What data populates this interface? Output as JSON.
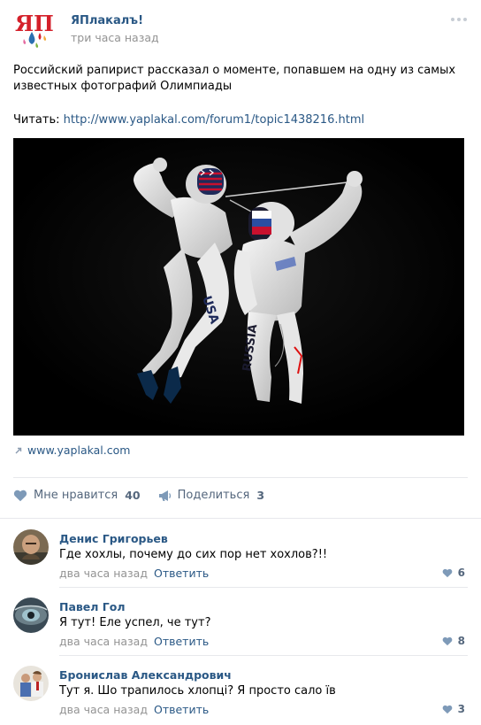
{
  "post": {
    "group_name": "ЯПлакалъ!",
    "logo_text": "ЯП",
    "time": "три часа назад",
    "text": "Российский рапирист рассказал о моменте, попавшем на одну из самых известных фотографий Олимпиады",
    "read_prefix": "Читать: ",
    "read_link": "http://www.yaplakal.com/forum1/topic1438216.html",
    "source_link": "www.yaplakal.com",
    "photo_text_usa": "USA",
    "photo_text_russia": "RUSSIA"
  },
  "actions": {
    "like_label": "Мне нравится",
    "like_count": "40",
    "share_label": "Поделиться",
    "share_count": "3"
  },
  "comments": [
    {
      "author": "Денис Григорьев",
      "text": "Где хохлы, почему до сих пор нет хохлов?!!",
      "time": "два часа назад",
      "reply": "Ответить",
      "likes": "6"
    },
    {
      "author": "Павел Гол",
      "text": "Я тут! Еле успел, че тут?",
      "time": "два часа назад",
      "reply": "Ответить",
      "likes": "8"
    },
    {
      "author": "Бронислав Александрович",
      "text": "Тут я. Шо трапилось хлопцi? Я просто сало їв",
      "time": "два часа назад",
      "reply": "Ответить",
      "likes": "3"
    }
  ],
  "colors": {
    "link": "#2a5885",
    "muted": "#939393",
    "action": "#55677d",
    "logo_red": "#d4202a",
    "logo_blue": "#2a6fb0"
  },
  "icons": [
    "more-icon",
    "external-link-icon",
    "heart-icon",
    "megaphone-icon"
  ]
}
